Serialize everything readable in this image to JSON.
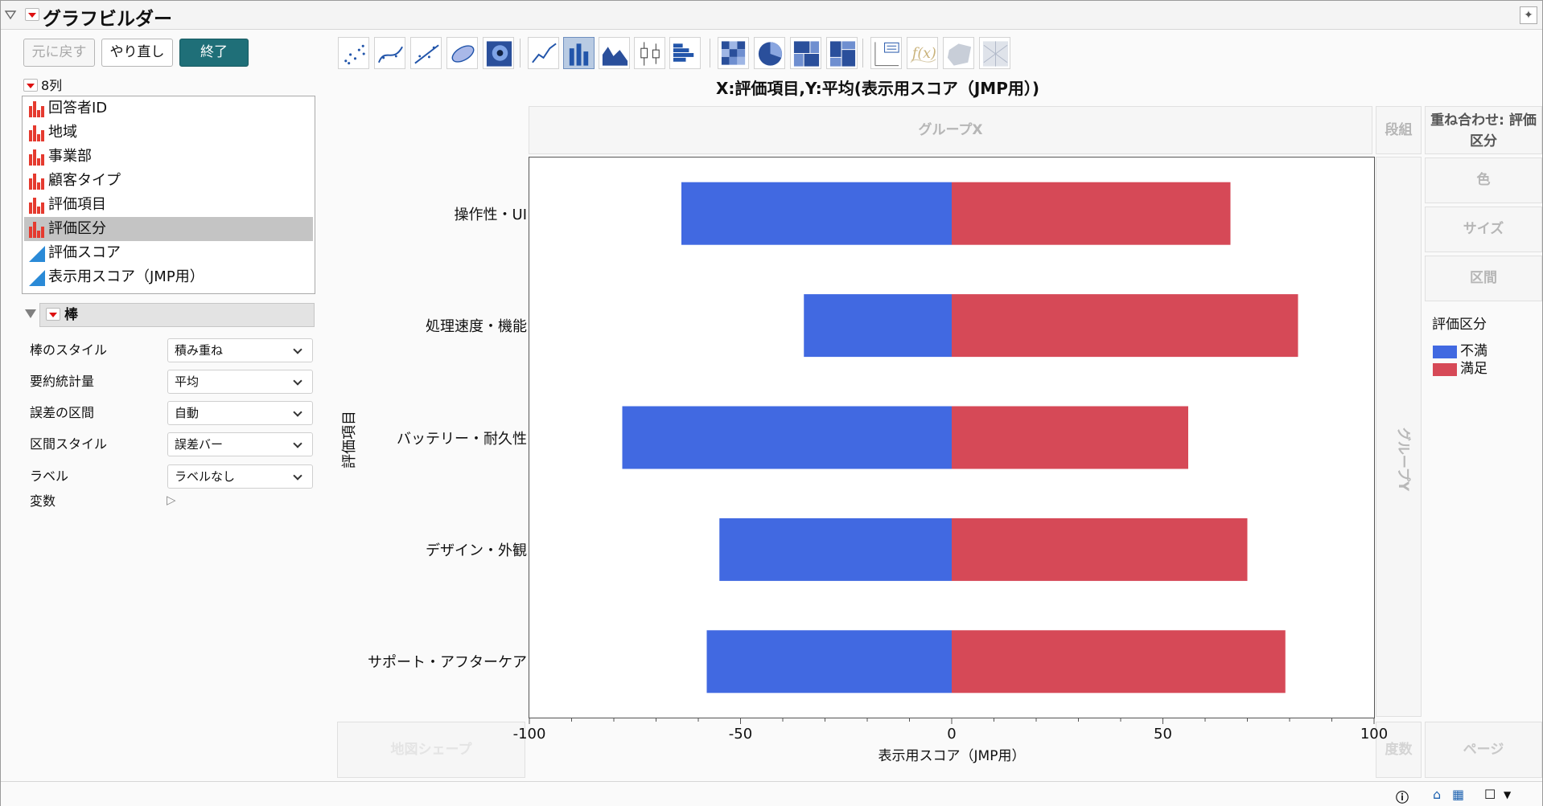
{
  "app": {
    "title": "グラフビルダー"
  },
  "controls": {
    "undo": "元に戻す",
    "redo": "やり直し",
    "done": "終了"
  },
  "columns": {
    "header": "8列",
    "items": [
      {
        "label": "回答者ID",
        "type": "nominal"
      },
      {
        "label": "地域",
        "type": "nominal"
      },
      {
        "label": "事業部",
        "type": "nominal"
      },
      {
        "label": "顧客タイプ",
        "type": "nominal"
      },
      {
        "label": "評価項目",
        "type": "nominal"
      },
      {
        "label": "評価区分",
        "type": "nominal",
        "selected": true
      },
      {
        "label": "評価スコア",
        "type": "continuous"
      },
      {
        "label": "表示用スコア（JMP用）",
        "type": "continuous"
      }
    ]
  },
  "bar_section": {
    "title": "棒",
    "props": [
      {
        "label": "棒のスタイル",
        "value": "積み重ね"
      },
      {
        "label": "要約統計量",
        "value": "平均"
      },
      {
        "label": "誤差の区間",
        "value": "自動"
      },
      {
        "label": "区間スタイル",
        "value": "誤差バー"
      },
      {
        "label": "ラベル",
        "value": "ラベルなし"
      }
    ],
    "variables_label": "変数"
  },
  "toolbar": {
    "icons": [
      "points-icon",
      "smoother-icon",
      "line-of-fit-icon",
      "ellipse-icon",
      "contour-icon",
      "line-chart-icon",
      "bar-chart-icon",
      "area-chart-icon",
      "box-plot-icon",
      "histogram-icon",
      "heatmap-icon",
      "pie-chart-icon",
      "treemap-icon",
      "mosaic-icon",
      "caption-box-icon",
      "formula-icon",
      "map-shape-icon",
      "parallel-plot-icon"
    ],
    "active": "bar-chart-icon"
  },
  "graph": {
    "title": "X:評価項目,Y:平均(表示用スコア（JMP用）)"
  },
  "zones": {
    "group_x": "グループX",
    "wrap": "段組",
    "overlay_line1": "重ね合わせ: 評価",
    "overlay_line2": "区分",
    "color": "色",
    "size": "サイズ",
    "interval": "区間",
    "group_y": "グループY",
    "map_shape": "地図シェープ",
    "freq": "度数",
    "page": "ページ"
  },
  "legend": {
    "title": "評価区分",
    "items": [
      {
        "label": "不満",
        "color": "#4169e1"
      },
      {
        "label": "満足",
        "color": "#d64957"
      }
    ]
  },
  "chart_data": {
    "type": "bar",
    "orientation": "horizontal",
    "stacked": true,
    "categories": [
      "操作性・UI",
      "処理速度・機能",
      "バッテリー・耐久性",
      "デザイン・外観",
      "サポート・アフターケア"
    ],
    "series": [
      {
        "name": "不満",
        "color": "#4169e1",
        "values": [
          -64,
          -35,
          -78,
          -55,
          -58
        ]
      },
      {
        "name": "満足",
        "color": "#d64957",
        "values": [
          66,
          82,
          56,
          70,
          79
        ]
      }
    ],
    "xlabel": "表示用スコア（JMP用）",
    "ylabel": "評価項目",
    "xlim": [
      -100,
      100
    ],
    "xticks": [
      -100,
      -50,
      0,
      50,
      100
    ],
    "grid": false,
    "legend_position": "right"
  }
}
